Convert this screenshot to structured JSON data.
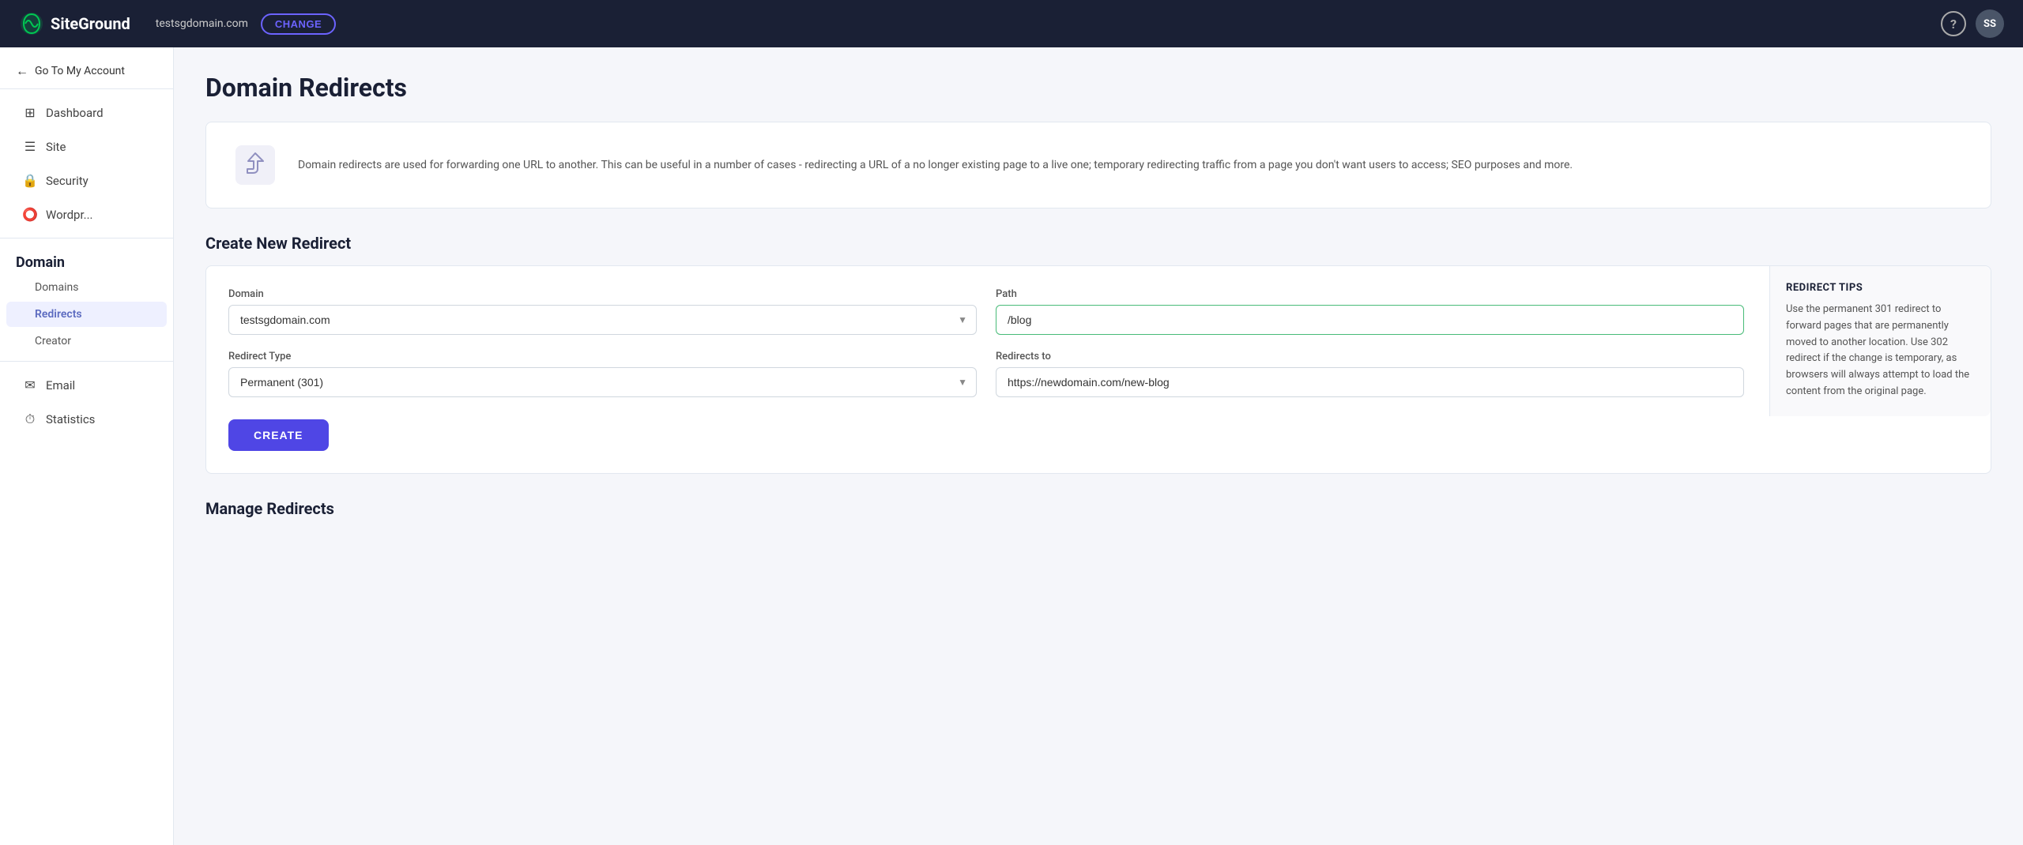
{
  "header": {
    "logo_text": "SiteGround",
    "domain": "testsgdomain.com",
    "change_label": "CHANGE",
    "help_icon": "?",
    "avatar_text": "SS"
  },
  "sidebar": {
    "back_label": "Go To My Account",
    "items": [
      {
        "id": "dashboard",
        "label": "Dashboard",
        "icon": "⊞"
      },
      {
        "id": "site",
        "label": "Site",
        "icon": "☰"
      },
      {
        "id": "security",
        "label": "Security",
        "icon": "🔒"
      },
      {
        "id": "wordpress",
        "label": "Wordpr...",
        "icon": "⭕"
      }
    ],
    "section_title": "Domain",
    "sub_items": [
      {
        "id": "domains",
        "label": "Domains"
      },
      {
        "id": "redirects",
        "label": "Redirects",
        "active": true
      },
      {
        "id": "creator",
        "label": "Creator"
      }
    ],
    "bottom_items": [
      {
        "id": "email",
        "label": "Email",
        "icon": "✉"
      },
      {
        "id": "statistics",
        "label": "Statistics",
        "icon": "⏱"
      }
    ]
  },
  "main": {
    "page_title": "Domain Redirects",
    "info_text": "Domain redirects are used for forwarding one URL to another. This can be useful in a number of cases - redirecting a URL of a no longer existing page to a live one; temporary redirecting traffic from a page you don't want users to access; SEO purposes and more.",
    "create_section_title": "Create New Redirect",
    "form": {
      "domain_label": "Domain",
      "domain_value": "testsgdomain.com",
      "path_label": "Path",
      "path_value": "/blog",
      "redirect_type_label": "Redirect Type",
      "redirect_type_value": "Permanent (301)",
      "redirects_to_label": "Redirects to",
      "redirects_to_value": "https://newdomain.com/new-blog",
      "create_button": "CREATE"
    },
    "tips": {
      "title": "REDIRECT TIPS",
      "text": "Use the permanent 301 redirect to forward pages that are permanently moved to another location. Use 302 redirect if the change is temporary, as browsers will always attempt to load the content from the original page."
    },
    "manage_title": "Manage Redirects"
  }
}
